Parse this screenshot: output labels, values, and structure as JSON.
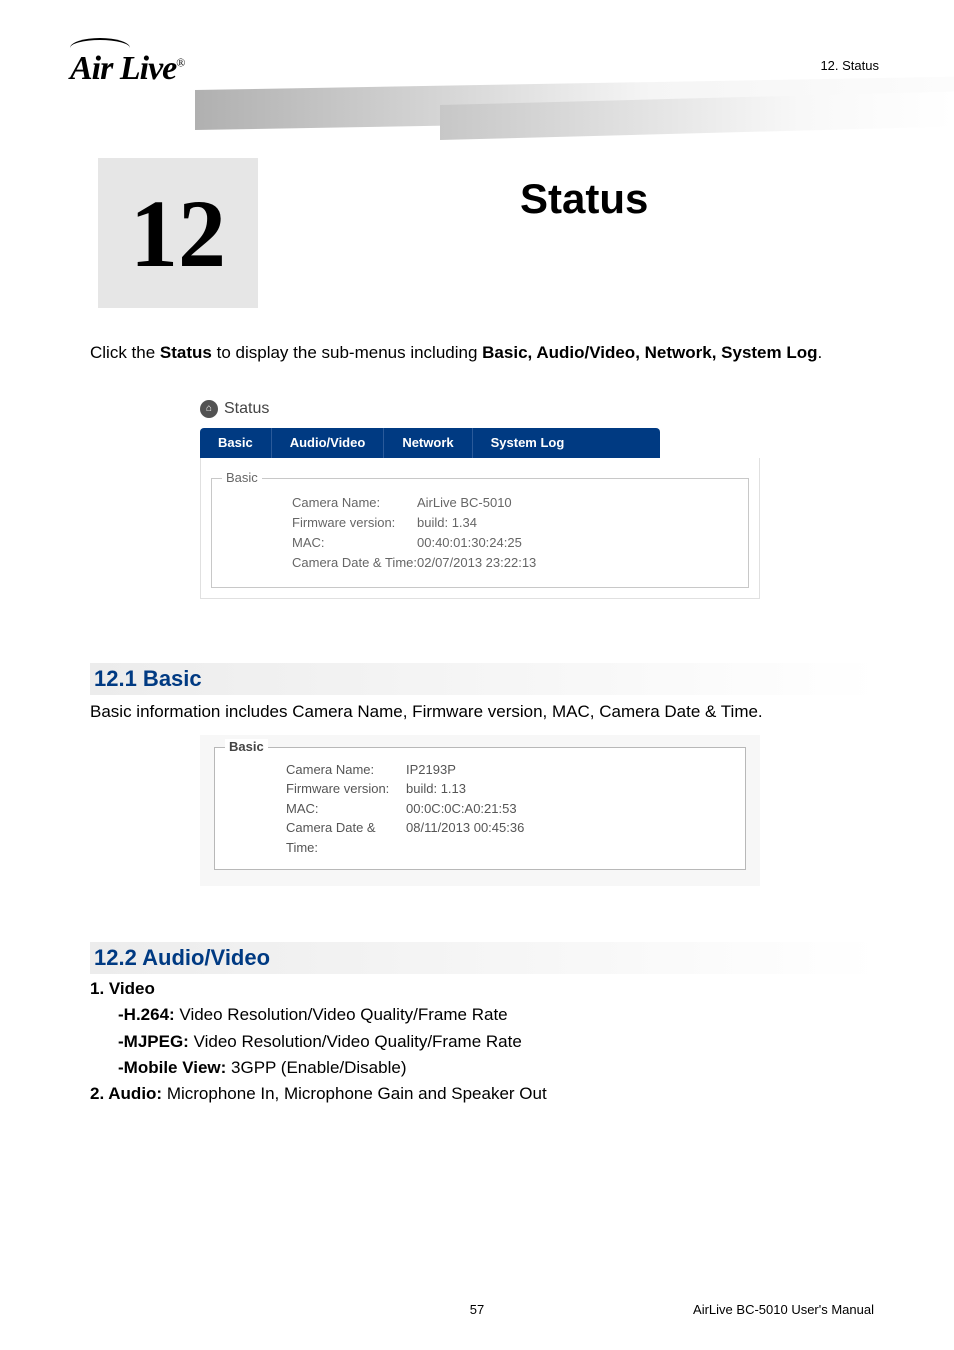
{
  "header": {
    "logo_text": "Air Live",
    "logo_reg": "®",
    "breadcrumb": "12. Status"
  },
  "chapter": {
    "number": "12",
    "title": "Status"
  },
  "intro": {
    "pre": "Click the ",
    "b1": "Status",
    "mid": " to display the sub-menus including ",
    "b2": "Basic, Audio/Video, Network, System Log",
    "post": "."
  },
  "figure1": {
    "status_label": "Status",
    "tabs": [
      "Basic",
      "Audio/Video",
      "Network",
      "System Log"
    ],
    "legend": "Basic",
    "rows": [
      {
        "k": "Camera Name:",
        "v": "AirLive BC-5010"
      },
      {
        "k": "Firmware version:",
        "v": "build: 1.34"
      },
      {
        "k": "MAC:",
        "v": "00:40:01:30:24:25"
      },
      {
        "k": "Camera Date & Time:",
        "v": "02/07/2013 23:22:13"
      }
    ]
  },
  "section1": {
    "heading": "12.1 Basic",
    "text": "Basic information includes Camera Name, Firmware version, MAC, Camera Date & Time."
  },
  "figure2": {
    "legend": "Basic",
    "rows": [
      {
        "k": "Camera Name:",
        "v": "IP2193P"
      },
      {
        "k": "Firmware version:",
        "v": "build: 1.13"
      },
      {
        "k": "MAC:",
        "v": "00:0C:0C:A0:21:53"
      },
      {
        "k": "Camera Date & Time:",
        "v": "08/11/2013 00:45:36"
      }
    ]
  },
  "section2": {
    "heading": "12.2 Audio/Video",
    "item1_label": "1. Video",
    "h264_b": "-H.264:",
    "h264_t": " Video Resolution/Video Quality/Frame Rate",
    "mjpeg_b": "-MJPEG:",
    "mjpeg_t": " Video Resolution/Video Quality/Frame Rate",
    "mobile_b": "-Mobile View:",
    "mobile_t": " 3GPP (Enable/Disable)",
    "item2_b": "2. Audio:",
    "item2_t": " Microphone In, Microphone Gain and Speaker Out"
  },
  "footer": {
    "page": "57",
    "doc": "AirLive BC-5010 User's Manual"
  }
}
